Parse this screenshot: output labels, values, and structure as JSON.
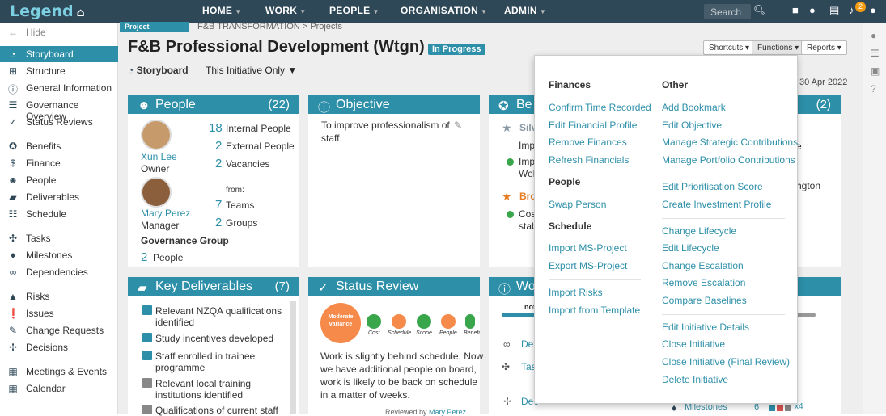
{
  "topbar": {
    "logo": "Legend",
    "nav": [
      "HOME",
      "WORK",
      "PEOPLE",
      "ORGANISATION",
      "ADMIN"
    ],
    "search_placeholder": "Search",
    "notifications": "2"
  },
  "sidebar": {
    "hide": "Hide",
    "items": [
      "Storyboard",
      "Structure",
      "General Information",
      "Governance Overview",
      "Status Reviews",
      "Benefits",
      "Finance",
      "People",
      "Deliverables",
      "Schedule",
      "Tasks",
      "Milestones",
      "Dependencies",
      "Risks",
      "Issues",
      "Change Requests",
      "Decisions",
      "Meetings & Events",
      "Calendar"
    ]
  },
  "header": {
    "tag": "Project",
    "breadcrumb": "F&B TRANSFORMATION > Projects",
    "title": "F&B Professional Development (Wtgn)",
    "status": "In Progress",
    "storyboard": "Storyboard",
    "filter": "This Initiative Only",
    "buttons": [
      "Shortcuts",
      "Functions",
      "Reports"
    ],
    "date": "30 Apr 2022"
  },
  "people": {
    "title": "People",
    "count": "(22)",
    "p1_name": "Xun Lee",
    "p1_role": "Owner",
    "p2_name": "Mary Perez",
    "p2_role": "Manager",
    "internal_n": "18",
    "internal": "Internal People",
    "external_n": "2",
    "external": "External People",
    "vacancies_n": "2",
    "vacancies": "Vacancies",
    "from": "from:",
    "teams_n": "7",
    "teams": "Teams",
    "groups_n": "2",
    "groups": "Groups",
    "gov": "Governance Group",
    "gov_n": "2",
    "gov_people": "People"
  },
  "objective": {
    "title": "Objective",
    "text1": "To improve professionalism of",
    "text2": "staff."
  },
  "benefits": {
    "title": "Be",
    "silver": "Silv",
    "l1": "Impr",
    "l2": "Impr",
    "l3": "Well",
    "bronze": "Bro",
    "l4": "Cos",
    "l5": "stab"
  },
  "thirdcard": {
    "count": "(2)",
    "t1": "e",
    "t2": "ngton"
  },
  "deliverables": {
    "title": "Key Deliverables",
    "count": "(7)",
    "items": [
      "Relevant NZQA qualifications",
      "identified",
      "Study incentives developed",
      "Staff enrolled in trainee",
      "programme",
      "Relevant local training",
      "institutions identified",
      "Qualifications of current staff"
    ]
  },
  "statusreview": {
    "title": "Status Review",
    "overall1": "Moderate",
    "overall2": "variance",
    "labels": [
      "Cost",
      "Schedule",
      "Scope",
      "People",
      "Benefi"
    ],
    "text": [
      "Work is slightly behind schedule. Now",
      "we have additional people on board,",
      "work is likely to be back on schedule",
      "in a matter of weeks."
    ],
    "reviewed": "Reviewed by",
    "reviewer": "Mary Perez"
  },
  "work": {
    "title": "Wo",
    "not": "not",
    "dep": "Dep",
    "tas": "Tas",
    "dec": "Dec",
    "milestones": "Milestones",
    "mcount": "6",
    "x4": "x4"
  },
  "functions_menu": {
    "finances": "Finances",
    "finance_items": [
      "Confirm Time Recorded",
      "Edit Financial Profile",
      "Remove Finances",
      "Refresh Financials"
    ],
    "people": "People",
    "people_items": [
      "Swap Person"
    ],
    "schedule": "Schedule",
    "schedule_items": [
      "Import MS-Project",
      "Export MS-Project"
    ],
    "risk_items": [
      "Import Risks",
      "Import from Template"
    ],
    "other": "Other",
    "other_items": [
      "Add Bookmark",
      "Edit Objective",
      "Manage Strategic Contributions",
      "Manage Portfolio Contributions",
      "Edit Prioritisation Score",
      "Create Investment Profile",
      "Change Lifecycle",
      "Edit Lifecycle",
      "Change Escalation",
      "Remove Escalation",
      "Compare Baselines",
      "Edit Initiative Details",
      "Close Initiative",
      "Close Initiative (Final Review)",
      "Delete Initiative"
    ]
  },
  "colors": {
    "accent": "#2d8fa8",
    "topbar": "#2f4858",
    "orange": "#f58a4b",
    "green": "#3aa64c"
  }
}
